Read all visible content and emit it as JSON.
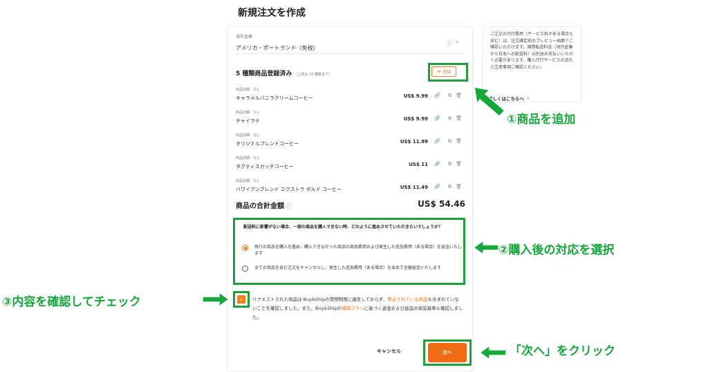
{
  "page": {
    "title": "新規注文を作成"
  },
  "warehouse": {
    "caption": "海外倉庫",
    "value": "アメリカ・ポートランド（免税）",
    "info_icon": "ⓘ",
    "chevron_icon": "›"
  },
  "products": {
    "title": "5 種類商品登録済み",
    "limit_note": "（上限は 10 種類まで）",
    "add_label": "追加",
    "add_icon": "+",
    "items": [
      {
        "caption": "商品詳細：なし",
        "name": "キャラメルバニラクリームコーヒー",
        "price": "US$ 9.99"
      },
      {
        "caption": "商品詳細：なし",
        "name": "チャイラテ",
        "price": "US$ 9.99"
      },
      {
        "caption": "商品詳細：なし",
        "name": "オリジナルブレンドコーヒー",
        "price": "US$ 11.99"
      },
      {
        "caption": "商品詳細：なし",
        "name": "タクティスカッチコーヒー",
        "price": "US$ 11"
      },
      {
        "caption": "商品詳細：なし",
        "name": "ハワイアンブレンド エクストラ ボルド コーヒー",
        "price": "US$ 11.49"
      }
    ],
    "icons": {
      "link": "🔗",
      "copy": "⧉",
      "trash": "🗑"
    }
  },
  "total": {
    "label": "商品の合計金額",
    "info_icon": "ⓘ",
    "amount": "US$ 54.46"
  },
  "choice": {
    "question": "配送料に影響がない場合、一部の商品を購入できない時、どのように進めさせていただきたいでしょうか？",
    "options": [
      {
        "text": "残りの商品を購入を進め、購入できなかった商品の商品費用および発生した追加費用（ある場合）を返金いたします",
        "selected": true
      },
      {
        "text": "全ての商品を含む注文をキャンセルし、発生した追加費用（ある場合）を含めて全額返金いたします",
        "selected": false
      }
    ]
  },
  "agreement": {
    "checked": true,
    "part1": "リクエストされた商品は Buy&Shipの荷物制限に違反しておらず、",
    "link1": "禁止されている商品",
    "part2": "も含まれていないことを確認しました。また、Buy&Shipの",
    "link2": "補償プラン",
    "part3": "に基づく返金および返品の承認基準も確認しました。"
  },
  "actions": {
    "cancel": "キャンセル",
    "next": "次へ"
  },
  "side": {
    "text": "ご注文の代行費用（サービス料がある場合も含む）は、注文確定前のプレビュー画面でご確認いただけます。国際転送料金（海外倉庫から日本への配送料）は別途お支払いいただく必要があります。購入代行サービスの流れと注意事項ご確認ください。",
    "link": "詳しくはこちらへ",
    "link_arrow": "›"
  },
  "annotations": {
    "step1": "①商品を追加",
    "step2": "②購入後の対応を選択",
    "step3": "③内容を確認してチェック",
    "step4": "「次へ」をクリック"
  },
  "colors": {
    "accent": "#ff6a00",
    "annotation_green": "#1f9f39"
  }
}
